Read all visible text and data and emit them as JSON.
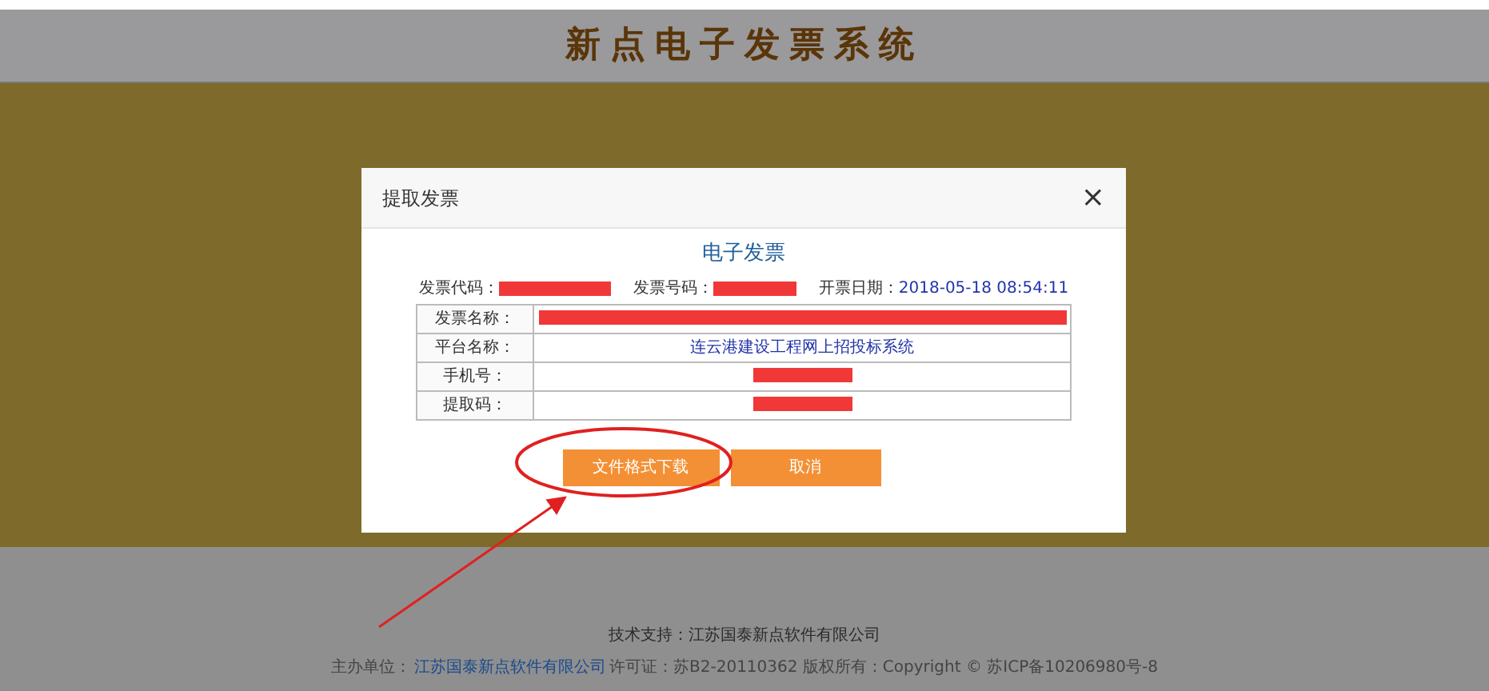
{
  "header": {
    "title": "新点电子发票系统"
  },
  "dialog": {
    "title": "提取发票",
    "close": "×",
    "heading": "电子发票",
    "info": [
      {
        "label": "发票代码：",
        "redacted": true
      },
      {
        "label": "发票号码：",
        "redacted": true
      },
      {
        "label": "开票日期：",
        "value": "2018-05-18 08:54:11",
        "redacted": false
      }
    ],
    "rows": [
      {
        "label": "发票名称：",
        "redacted": true
      },
      {
        "label": "平台名称：",
        "value": "连云港建设工程网上招投标系统",
        "redacted": false
      },
      {
        "label": "手机号：",
        "redacted": true
      },
      {
        "label": "提取码：",
        "redacted": true
      }
    ],
    "buttons": [
      "文件格式下载",
      "取消"
    ]
  },
  "footer": {
    "support": "技术支持：江苏国泰新点软件有限公司",
    "host_label": "主办单位：",
    "host_link": "江苏国泰新点软件有限公司",
    "license": "许可证：苏B2-20110362 版权所有：Copyright © 苏ICP备10206980号-8"
  }
}
